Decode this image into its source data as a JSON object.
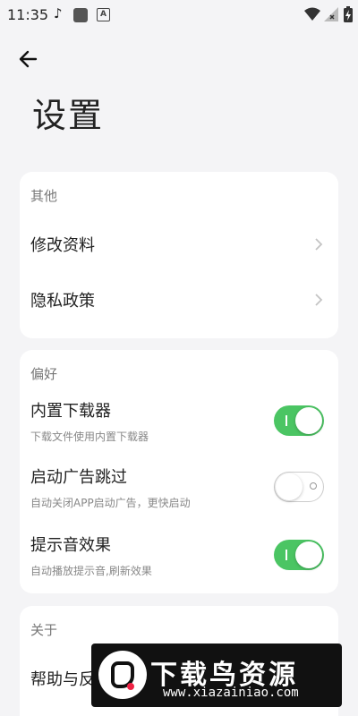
{
  "status": {
    "time": "11:35"
  },
  "page": {
    "title": "设置"
  },
  "other": {
    "section": "其他",
    "items": [
      {
        "label": "修改资料"
      },
      {
        "label": "隐私政策"
      }
    ]
  },
  "prefs": {
    "section": "偏好",
    "items": [
      {
        "label": "内置下载器",
        "desc": "下载文件使用内置下载器",
        "enabled": true
      },
      {
        "label": "启动广告跳过",
        "desc": "自动关闭APP启动广告，更快启动",
        "enabled": false
      },
      {
        "label": "提示音效果",
        "desc": "自动播放提示音,刷新效果",
        "enabled": true
      }
    ]
  },
  "about": {
    "section": "关于",
    "items": [
      {
        "label": "帮助与反"
      }
    ]
  },
  "watermark": {
    "brand": "下载鸟资源",
    "url": "www.xiazainiao.com"
  },
  "colors": {
    "accent": "#4bc563",
    "background": "#f4f4f6"
  }
}
